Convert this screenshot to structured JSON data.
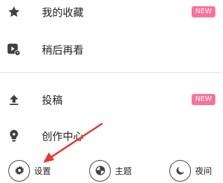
{
  "menu": {
    "items": [
      {
        "label": "我的收藏",
        "icon": "star-icon",
        "badge": "NEW"
      },
      {
        "label": "稍后再看",
        "icon": "watch-later-icon",
        "badge": null
      },
      {
        "label": "投稿",
        "icon": "upload-icon",
        "badge": "NEW"
      },
      {
        "label": "创作中心",
        "icon": "bulb-icon",
        "badge": null
      }
    ]
  },
  "bottom": {
    "settings_label": "设置",
    "theme_label": "主题",
    "night_label": "夜间"
  },
  "colors": {
    "badge_bg": "#fb7299",
    "icon": "#404040",
    "annotation_arrow": "#e53935"
  }
}
